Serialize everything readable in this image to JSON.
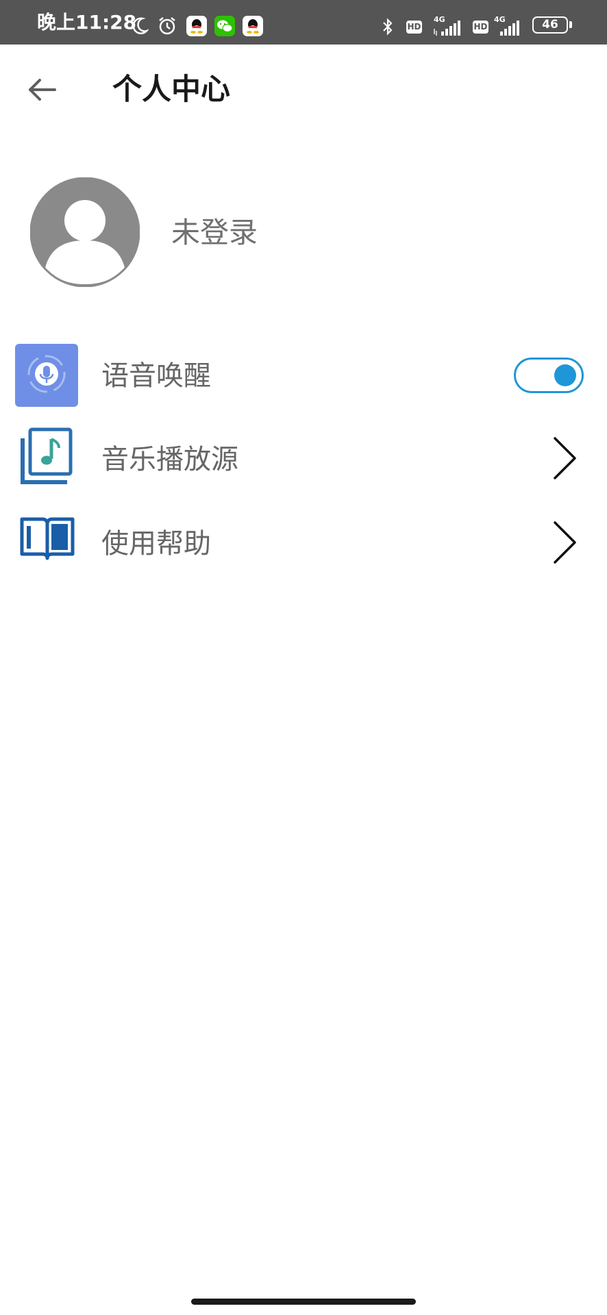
{
  "status_bar": {
    "time": "晚上11:28",
    "battery_level": "46",
    "hd_label": "HD",
    "network_label": "4G",
    "icons": [
      "moon-icon",
      "alarm-icon",
      "qq-icon",
      "wechat-icon",
      "qq-icon",
      "bluetooth-icon",
      "signal-icon",
      "battery-icon"
    ]
  },
  "header": {
    "title": "个人中心",
    "back_icon": "arrow-left-icon"
  },
  "profile": {
    "status": "未登录",
    "avatar_icon": "user-avatar-icon"
  },
  "menu": {
    "items": [
      {
        "label": "语音唤醒",
        "icon": "microphone-icon",
        "control": "toggle",
        "enabled": true
      },
      {
        "label": "音乐播放源",
        "icon": "music-library-icon",
        "control": "chevron"
      },
      {
        "label": "使用帮助",
        "icon": "book-icon",
        "control": "chevron"
      }
    ]
  },
  "colors": {
    "status_bar_bg": "#555555",
    "accent": "#1f96d8",
    "mic_tile": "#6f8fe6",
    "music_icon": "#2a6fb0",
    "music_note": "#3aa39a",
    "book_icon": "#1a5ea8",
    "label_text": "#666666"
  }
}
